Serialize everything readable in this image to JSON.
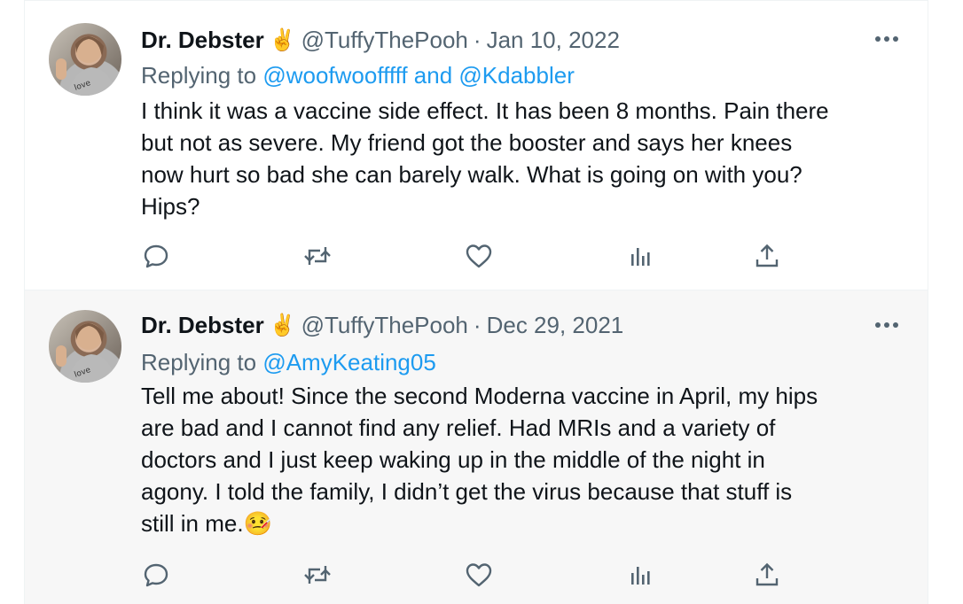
{
  "colors": {
    "link": "#1d9bf0",
    "secondary": "#536471",
    "text": "#0f1419"
  },
  "tweets": [
    {
      "author": "Dr. Debster",
      "badge": "✌️",
      "handle": "@TuffyThePooh",
      "separator": "·",
      "date": "Jan 10, 2022",
      "reply_prefix": "Replying to",
      "mention_text": "@woofwoofffff and @Kdabbler",
      "body_lines": [
        "I think it was a vaccine side effect. It has been 8 months. Pain there",
        "but not as severe. My friend got the booster and says her knees",
        "now hurt so bad she can barely walk. What is going on with you?",
        "Hips?"
      ],
      "more_icon": "more-icon",
      "actions": [
        "reply-icon",
        "retweet-icon",
        "like-icon",
        "views-icon",
        "share-icon"
      ]
    },
    {
      "author": "Dr. Debster",
      "badge": "✌️",
      "handle": "@TuffyThePooh",
      "separator": "·",
      "date": "Dec 29, 2021",
      "reply_prefix": "Replying to",
      "mention_text": "@AmyKeating05",
      "body_lines": [
        "Tell me about! Since the second Moderna vaccine in April, my hips",
        "are bad and I cannot find any relief. Had MRIs and a variety of",
        "doctors and I just keep waking up in the middle of the night in",
        "agony.  I told the family, I didn’t get the virus because that stuff is",
        "still in me.🤒"
      ],
      "more_icon": "more-icon",
      "actions": [
        "reply-icon",
        "retweet-icon",
        "like-icon",
        "views-icon",
        "share-icon"
      ]
    }
  ]
}
